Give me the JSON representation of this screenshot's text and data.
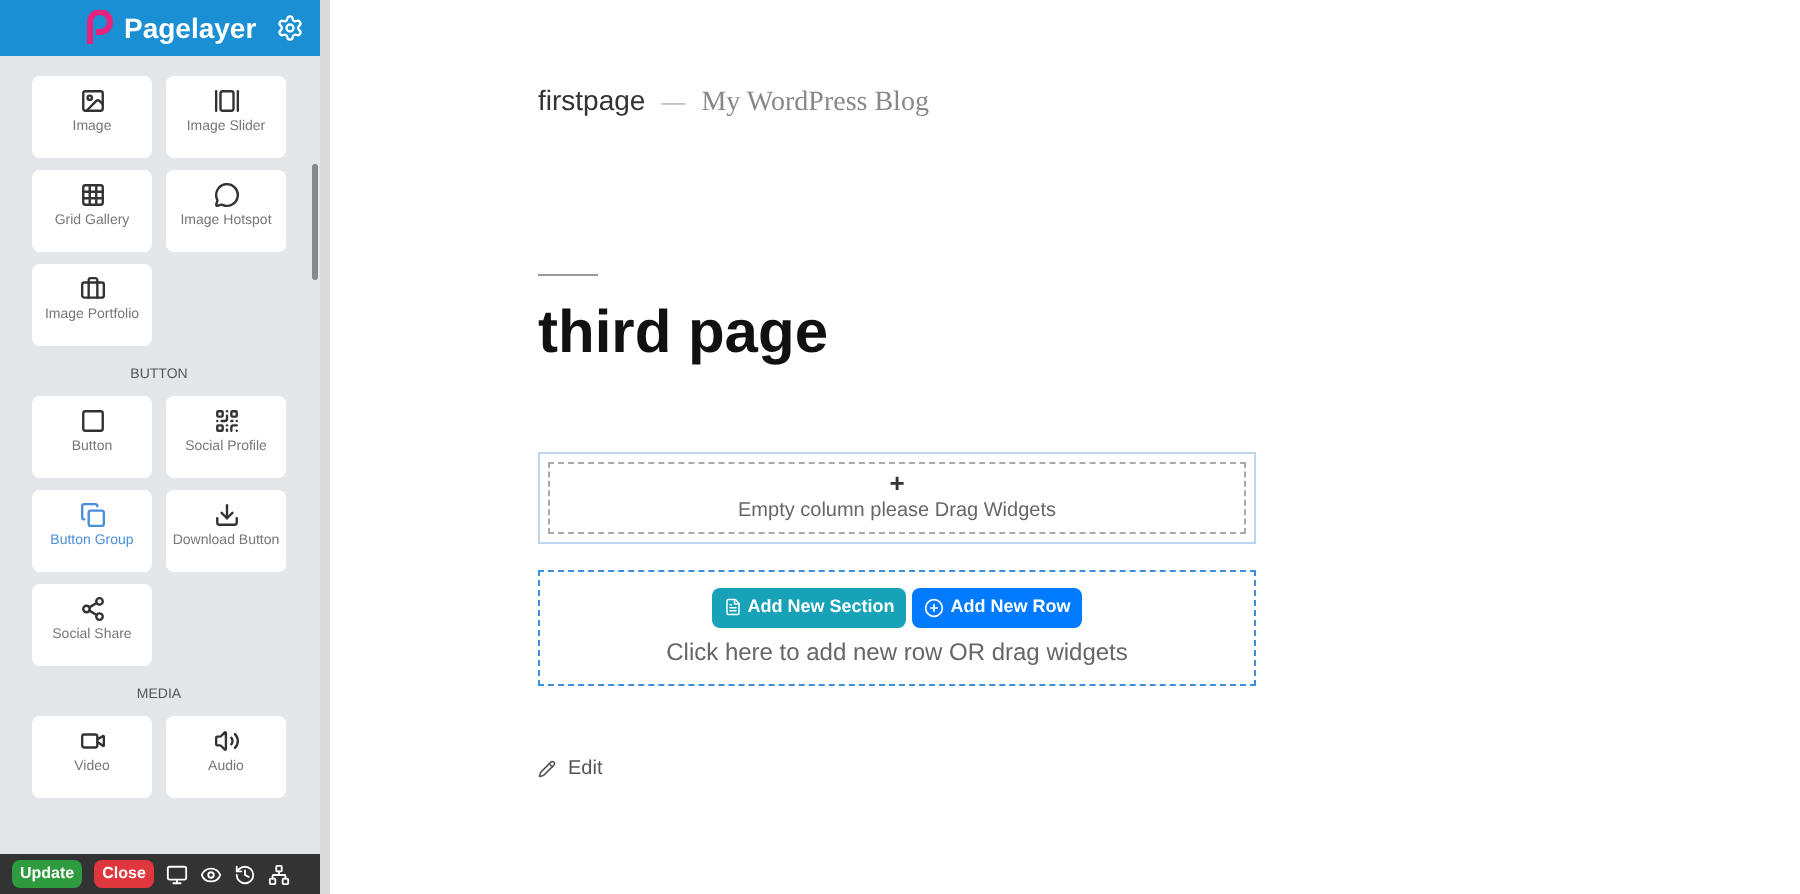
{
  "sidebar": {
    "brand": "Pagelayer",
    "sections": [
      {
        "widgets": [
          {
            "label": "Image",
            "selected": false
          },
          {
            "label": "Image Slider",
            "selected": false
          },
          {
            "label": "Grid Gallery",
            "selected": false
          },
          {
            "label": "Image Hotspot",
            "selected": false
          },
          {
            "label": "Image Portfolio",
            "selected": false
          }
        ]
      },
      {
        "title": "BUTTON",
        "widgets": [
          {
            "label": "Button",
            "selected": false
          },
          {
            "label": "Social Profile",
            "selected": false
          },
          {
            "label": "Button Group",
            "selected": true
          },
          {
            "label": "Download Button",
            "selected": false
          },
          {
            "label": "Social Share",
            "selected": false
          }
        ]
      },
      {
        "title": "MEDIA",
        "widgets": [
          {
            "label": "Video",
            "selected": false
          },
          {
            "label": "Audio",
            "selected": false
          }
        ]
      }
    ],
    "footer": {
      "update": "Update",
      "close": "Close"
    }
  },
  "page": {
    "site_title": "firstpage",
    "separator": "—",
    "tagline": "My WordPress Blog",
    "heading": "third page",
    "empty_column": {
      "plus": "+",
      "text": "Empty column please Drag Widgets"
    },
    "add_section": "Add New Section",
    "add_row": "Add New Row",
    "add_hint": "Click here to add new row OR drag widgets",
    "edit": "Edit"
  }
}
